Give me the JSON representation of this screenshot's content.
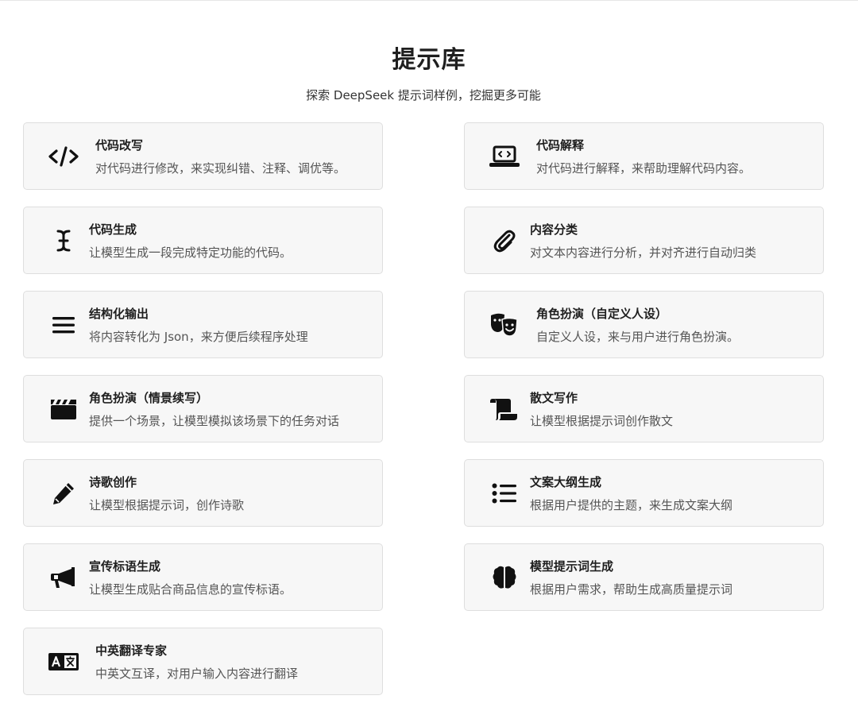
{
  "header": {
    "title": "提示库",
    "subtitle": "探索 DeepSeek 提示词样例，挖掘更多可能"
  },
  "cards": [
    {
      "title": "代码改写",
      "desc": "对代码进行修改，来实现纠错、注释、调优等。",
      "icon": "code-icon"
    },
    {
      "title": "代码解释",
      "desc": "对代码进行解释，来帮助理解代码内容。",
      "icon": "laptop-code-icon"
    },
    {
      "title": "代码生成",
      "desc": "让模型生成一段完成特定功能的代码。",
      "icon": "text-cursor-icon"
    },
    {
      "title": "内容分类",
      "desc": "对文本内容进行分析，并对齐进行自动归类",
      "icon": "paperclip-icon"
    },
    {
      "title": "结构化输出",
      "desc": "将内容转化为 Json，来方便后续程序处理",
      "icon": "bars-icon"
    },
    {
      "title": "角色扮演（自定义人设）",
      "desc": "自定义人设，来与用户进行角色扮演。",
      "icon": "masks-theater-icon"
    },
    {
      "title": "角色扮演（情景续写）",
      "desc": "提供一个场景，让模型模拟该场景下的任务对话",
      "icon": "clapperboard-icon"
    },
    {
      "title": "散文写作",
      "desc": "让模型根据提示词创作散文",
      "icon": "scroll-icon"
    },
    {
      "title": "诗歌创作",
      "desc": "让模型根据提示词，创作诗歌",
      "icon": "pencil-icon"
    },
    {
      "title": "文案大纲生成",
      "desc": "根据用户提供的主题，来生成文案大纲",
      "icon": "list-icon"
    },
    {
      "title": "宣传标语生成",
      "desc": "让模型生成贴合商品信息的宣传标语。",
      "icon": "bullhorn-icon"
    },
    {
      "title": "模型提示词生成",
      "desc": "根据用户需求，帮助生成高质量提示词",
      "icon": "brain-icon"
    },
    {
      "title": "中英翻译专家",
      "desc": "中英文互译，对用户输入内容进行翻译",
      "icon": "language-icon"
    }
  ]
}
